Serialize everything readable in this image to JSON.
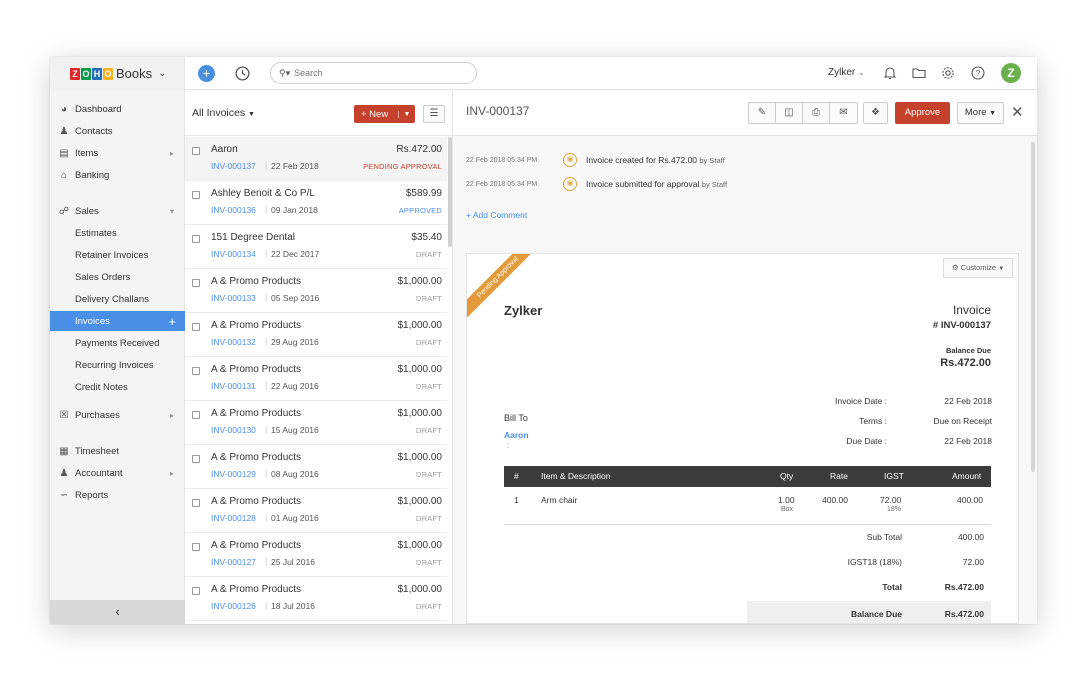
{
  "brand": {
    "zoho_letters": [
      {
        "ch": "Z",
        "color": "#e42527"
      },
      {
        "ch": "O",
        "color": "#089949"
      },
      {
        "ch": "H",
        "color": "#226db4"
      },
      {
        "ch": "O",
        "color": "#f9b21d"
      }
    ],
    "product": "Books"
  },
  "topbar": {
    "search_placeholder": "Search",
    "org_name": "Zylker",
    "avatar_letter": "Z",
    "icons": [
      "bell-icon",
      "folder-icon",
      "gear-icon",
      "help-icon"
    ]
  },
  "sidebar": {
    "items": [
      {
        "label": "Dashboard",
        "icon": "dashboard-icon"
      },
      {
        "label": "Contacts",
        "icon": "contacts-icon"
      },
      {
        "label": "Items",
        "icon": "items-icon"
      },
      {
        "label": "Banking",
        "icon": "bank-icon"
      },
      {
        "label": "Sales",
        "icon": "cart-icon"
      }
    ],
    "sales_sub": [
      "Estimates",
      "Retainer Invoices",
      "Sales Orders",
      "Delivery Challans",
      "Invoices",
      "Payments Received",
      "Recurring Invoices",
      "Credit Notes"
    ],
    "lower": [
      {
        "label": "Purchases",
        "icon": "bag-icon"
      },
      {
        "label": "Timesheet",
        "icon": "calendar-icon"
      },
      {
        "label": "Accountant",
        "icon": "accountant-icon"
      },
      {
        "label": "Reports",
        "icon": "chart-icon"
      }
    ],
    "collapse": "‹"
  },
  "list": {
    "title": "All Invoices",
    "new_label": "+ New",
    "rows": [
      {
        "customer": "Aaron",
        "number": "INV-000137",
        "date": "22 Feb 2018",
        "amount": "Rs.472.00",
        "status": "PENDING APPROVAL",
        "status_class": "pending"
      },
      {
        "customer": "Ashley Benoit & Co P/L",
        "number": "INV-000136",
        "date": "09 Jan 2018",
        "amount": "$589.99",
        "status": "APPROVED",
        "status_class": "approved"
      },
      {
        "customer": "151 Degree Dental",
        "number": "INV-000134",
        "date": "22 Dec 2017",
        "amount": "$35.40",
        "status": "DRAFT",
        "status_class": "draft"
      },
      {
        "customer": "A & Promo Products",
        "number": "INV-000133",
        "date": "05 Sep 2016",
        "amount": "$1,000.00",
        "status": "DRAFT",
        "status_class": "draft"
      },
      {
        "customer": "A & Promo Products",
        "number": "INV-000132",
        "date": "29 Aug 2016",
        "amount": "$1,000.00",
        "status": "DRAFT",
        "status_class": "draft"
      },
      {
        "customer": "A & Promo Products",
        "number": "INV-000131",
        "date": "22 Aug 2016",
        "amount": "$1,000.00",
        "status": "DRAFT",
        "status_class": "draft"
      },
      {
        "customer": "A & Promo Products",
        "number": "INV-000130",
        "date": "15 Aug 2016",
        "amount": "$1,000.00",
        "status": "DRAFT",
        "status_class": "draft"
      },
      {
        "customer": "A & Promo Products",
        "number": "INV-000129",
        "date": "08 Aug 2016",
        "amount": "$1,000.00",
        "status": "DRAFT",
        "status_class": "draft"
      },
      {
        "customer": "A & Promo Products",
        "number": "INV-000128",
        "date": "01 Aug 2016",
        "amount": "$1,000.00",
        "status": "DRAFT",
        "status_class": "draft"
      },
      {
        "customer": "A & Promo Products",
        "number": "INV-000127",
        "date": "25 Jul 2016",
        "amount": "$1,000.00",
        "status": "DRAFT",
        "status_class": "draft"
      },
      {
        "customer": "A & Promo Products",
        "number": "INV-000126",
        "date": "18 Jul 2016",
        "amount": "$1,000.00",
        "status": "DRAFT",
        "status_class": "draft"
      }
    ]
  },
  "detail": {
    "title": "INV-000137",
    "approve_label": "Approve",
    "more_label": "More",
    "timeline": [
      {
        "date": "22 Feb 2018 05:34 PM",
        "text": "Invoice created for Rs.472.00",
        "by": "by Staff"
      },
      {
        "date": "22 Feb 2018 05:34 PM",
        "text": "Invoice submitted for approval",
        "by": "by Staff"
      }
    ],
    "add_comment": "+ Add Comment",
    "ribbon": "Pending Approval",
    "customize": "Customize",
    "org": "Zylker",
    "doc_title": "Invoice",
    "doc_number": "# INV-000137",
    "balance_due_label": "Balance Due",
    "balance_due": "Rs.472.00",
    "meta": [
      {
        "k": "Invoice Date :",
        "v": "22 Feb 2018"
      },
      {
        "k": "Terms :",
        "v": "Due on Receipt"
      },
      {
        "k": "Due Date :",
        "v": "22 Feb 2018"
      }
    ],
    "bill_to": "Bill To",
    "bill_name": "Aaron",
    "bill_colon": ":",
    "table_head": {
      "idx": "#",
      "item": "Item & Description",
      "qty": "Qty",
      "rate": "Rate",
      "tax": "IGST",
      "amount": "Amount"
    },
    "line": {
      "idx": "1",
      "item": "Arm chair",
      "qty": "1.00",
      "unit": "Box",
      "rate": "400.00",
      "tax": "72.00",
      "tax_pct": "18%",
      "amount": "400.00"
    },
    "totals": [
      {
        "k": "Sub Total",
        "v": "400.00"
      },
      {
        "k": "IGST18 (18%)",
        "v": "72.00"
      },
      {
        "k": "Total",
        "v": "Rs.472.00"
      },
      {
        "k": "Balance Due",
        "v": "Rs.472.00"
      }
    ]
  },
  "colors": {
    "accent": "#4a8fe7",
    "primary_button": "#c6412c",
    "ribbon": "#e39a3b",
    "avatar": "#6ab04c"
  }
}
